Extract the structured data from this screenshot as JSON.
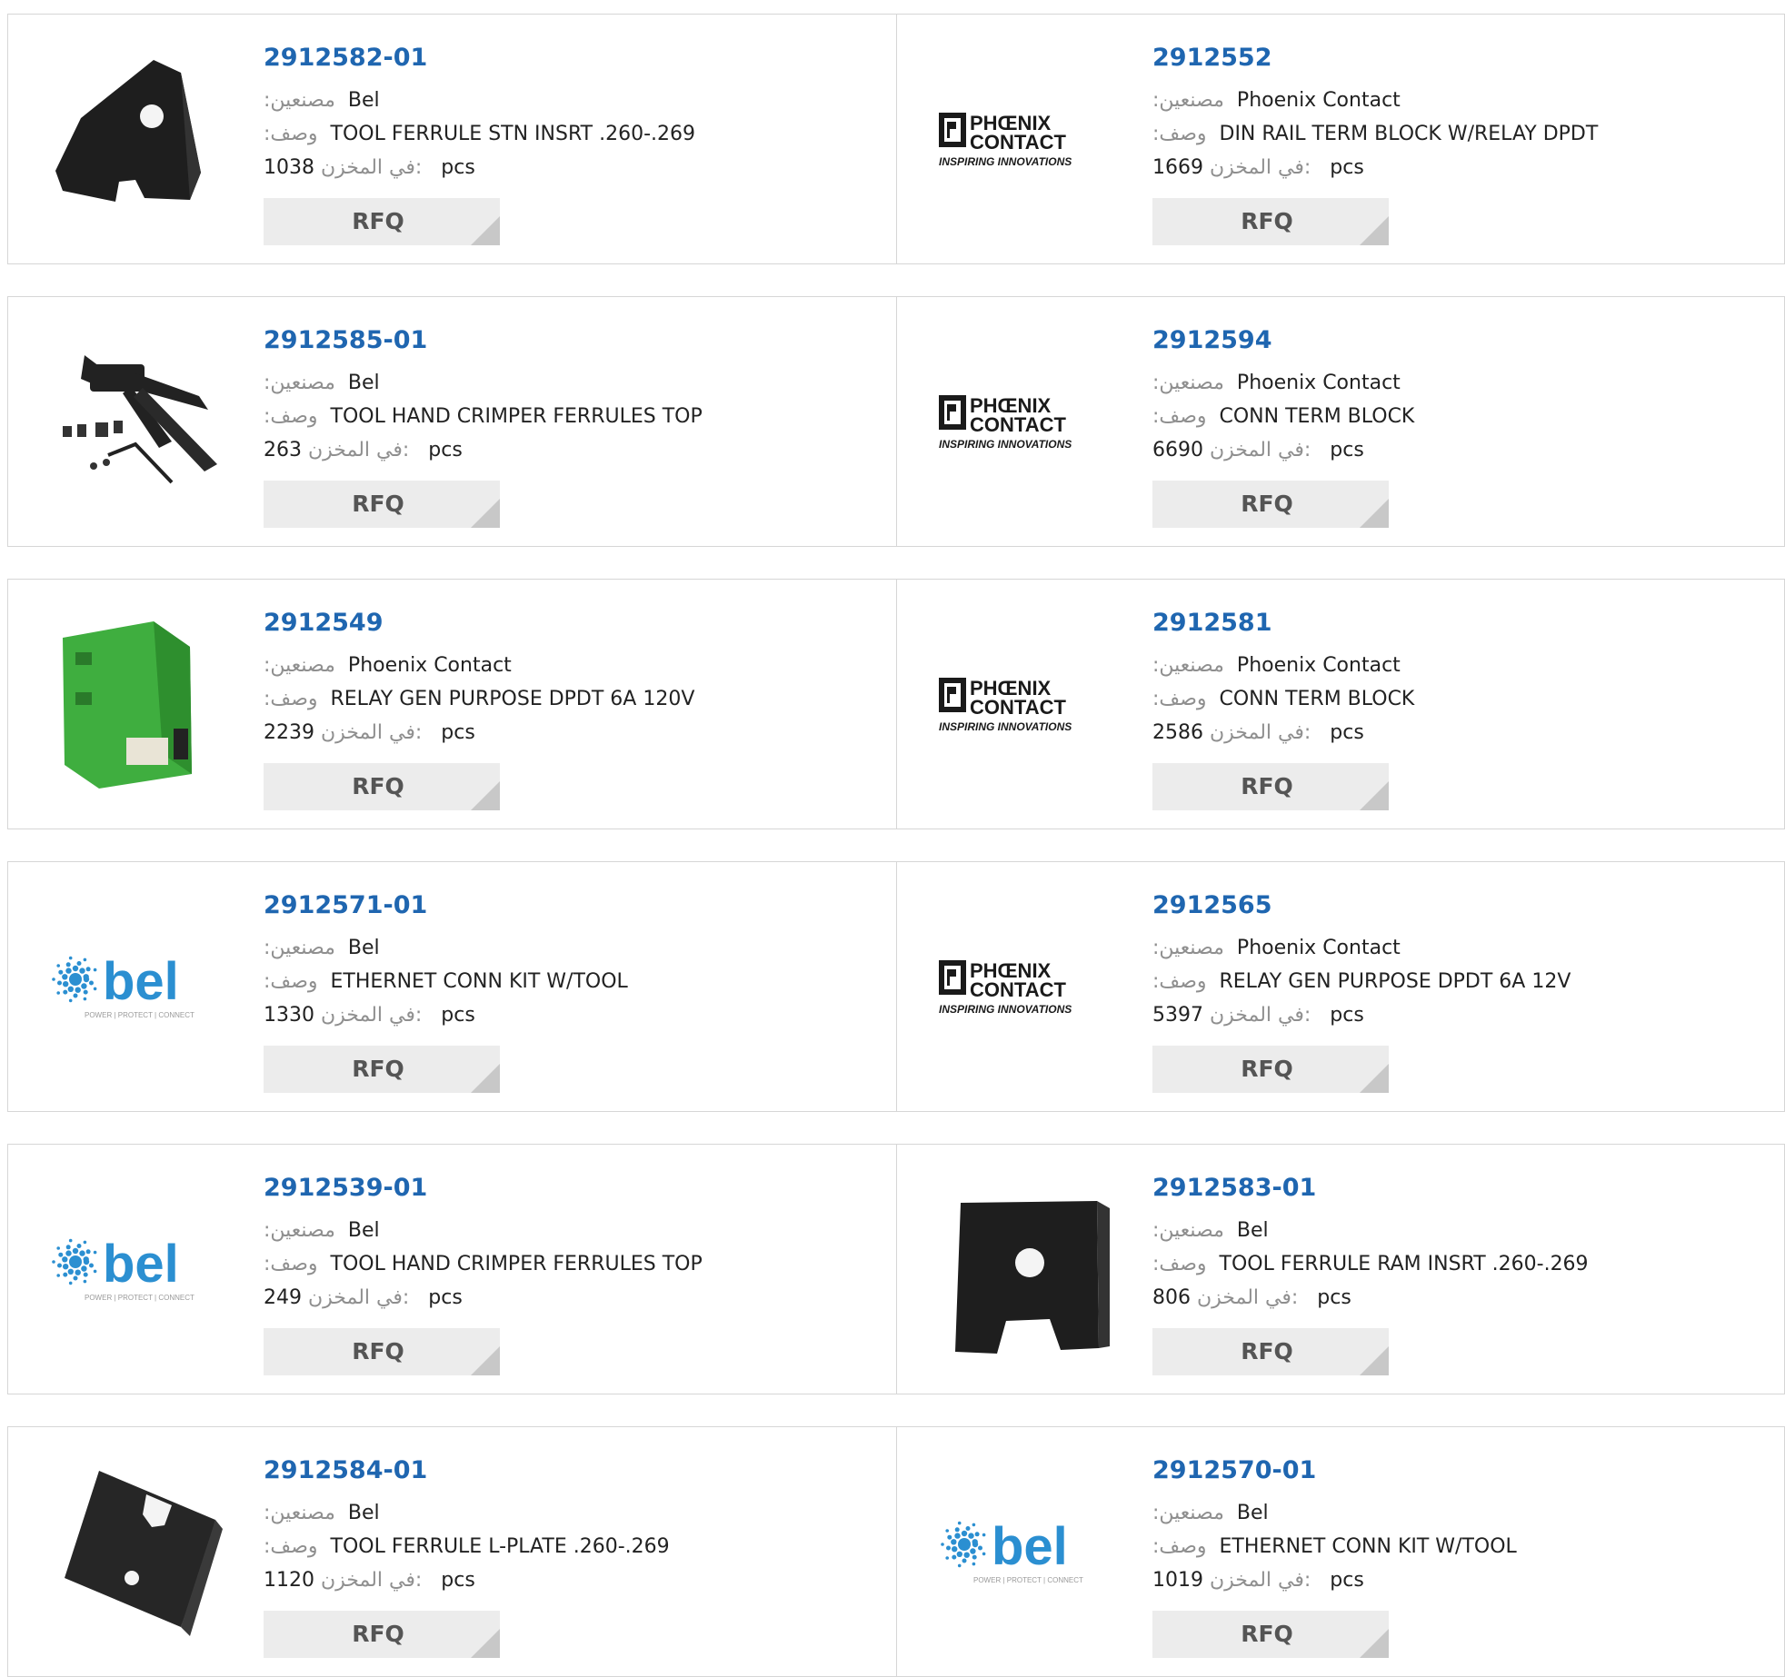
{
  "labels": {
    "manufacturer": ":مصنعين",
    "description": ":وصف",
    "stock": "في المخزن:",
    "unit": "pcs",
    "rfq": "RFQ"
  },
  "colors": {
    "link": "#1f66b0",
    "border": "#d6d6d6",
    "button_bg": "#ececec",
    "bel_blue": "#2b8fd1",
    "phoenix_logo": "#1a1a1a"
  },
  "rows": [
    {
      "left": {
        "pn": "2912582-01",
        "mfr": "Bel",
        "desc": "TOOL FERRULE STN INSRT .260-.269",
        "stock": "1038",
        "image": "ferrule-station-insert-photo"
      },
      "right": {
        "pn": "2912552",
        "mfr": "Phoenix Contact",
        "desc": "DIN RAIL TERM BLOCK W/RELAY DPDT",
        "stock": "1669",
        "image": "phoenix-contact-logo"
      }
    },
    {
      "left": {
        "pn": "2912585-01",
        "mfr": "Bel",
        "desc": "TOOL HAND CRIMPER FERRULES TOP",
        "stock": "263",
        "image": "hand-crimper-photo"
      },
      "right": {
        "pn": "2912594",
        "mfr": "Phoenix Contact",
        "desc": "CONN TERM BLOCK",
        "stock": "6690",
        "image": "phoenix-contact-logo"
      }
    },
    {
      "left": {
        "pn": "2912549",
        "mfr": "Phoenix Contact",
        "desc": "RELAY GEN PURPOSE DPDT 6A 120V",
        "stock": "2239",
        "image": "relay-module-photo"
      },
      "right": {
        "pn": "2912581",
        "mfr": "Phoenix Contact",
        "desc": "CONN TERM BLOCK",
        "stock": "2586",
        "image": "phoenix-contact-logo"
      }
    },
    {
      "left": {
        "pn": "2912571-01",
        "mfr": "Bel",
        "desc": "ETHERNET CONN KIT W/TOOL",
        "stock": "1330",
        "image": "bel-logo"
      },
      "right": {
        "pn": "2912565",
        "mfr": "Phoenix Contact",
        "desc": "RELAY GEN PURPOSE DPDT 6A 12V",
        "stock": "5397",
        "image": "phoenix-contact-logo"
      }
    },
    {
      "left": {
        "pn": "2912539-01",
        "mfr": "Bel",
        "desc": "TOOL HAND CRIMPER FERRULES TOP",
        "stock": "249",
        "image": "bel-logo"
      },
      "right": {
        "pn": "2912583-01",
        "mfr": "Bel",
        "desc": "TOOL FERRULE RAM INSRT .260-.269",
        "stock": "806",
        "image": "ferrule-ram-insert-photo"
      }
    },
    {
      "left": {
        "pn": "2912584-01",
        "mfr": "Bel",
        "desc": "TOOL FERRULE L-PLATE .260-.269",
        "stock": "1120",
        "image": "ferrule-l-plate-photo"
      },
      "right": {
        "pn": "2912570-01",
        "mfr": "Bel",
        "desc": "ETHERNET CONN KIT W/TOOL",
        "stock": "1019",
        "image": "bel-logo"
      }
    }
  ],
  "logos": {
    "phoenix_line1": "PHŒNIX",
    "phoenix_line2": "CONTACT",
    "phoenix_tagline": "INSPIRING INNOVATIONS",
    "bel_word": "bel",
    "bel_tagline": "POWER | PROTECT | CONNECT"
  }
}
